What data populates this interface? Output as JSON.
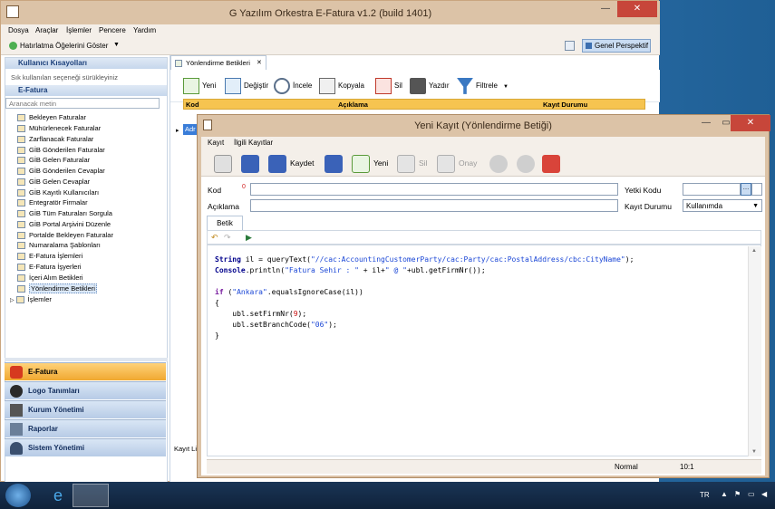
{
  "main_window": {
    "title": "G Yazılım Orkestra E-Fatura v1.2 (build 1401)",
    "menu": [
      "Dosya",
      "Araçlar",
      "İşlemler",
      "Pencere",
      "Yardım"
    ],
    "toolbar_reminder": "Hatırlatma Öğelerini Göster",
    "perspective_button": "Genel Perspektif"
  },
  "sidebar": {
    "shortcuts_header": "Kullanıcı Kısayolları",
    "shortcuts_hint": "Sık kullanılan seçeneği sürükleyiniz",
    "efatura_header": "E-Fatura",
    "search_placeholder": "Aranacak metin",
    "items": [
      "Bekleyen Faturalar",
      "Mühürlenecek Faturalar",
      "Zarflanacak Faturalar",
      "GİB Gönderilen Faturalar",
      "GİB Gelen Faturalar",
      "GİB Gönderilen Cevaplar",
      "GİB Gelen Cevaplar",
      "GİB Kayıtlı Kullanıcıları",
      "Entegratör Firmalar",
      "GİB Tüm Faturaları Sorgula",
      "GİB Portal Arşivini Düzenle",
      "Portalde Bekleyen Faturalar",
      "Numaralama Şablonları",
      "E-Fatura İşlemleri",
      "E-Fatura İşyerleri",
      "İçeri Alım Betikleri",
      "Yönlendirme Betikleri",
      "İşlemler"
    ],
    "nav_buttons": [
      "E-Fatura",
      "Logo Tanımları",
      "Kurum Yönetimi",
      "Raporlar",
      "Sistem Yönetimi"
    ]
  },
  "list_view": {
    "tab_label": "Yönlendirme Betikleri",
    "toolbar": [
      "Yeni",
      "Değiştir",
      "İncele",
      "Kopyala",
      "Sil",
      "Yazdır",
      "Filtrele"
    ],
    "columns": [
      "Kod",
      "Açıklama",
      "Kayıt Durumu"
    ],
    "row_partial": "Adr",
    "side_label_partial": "Kayıt Li"
  },
  "dialog": {
    "title": "Yeni Kayıt (Yönlendirme Betiği)",
    "menu": [
      "Kayıt",
      "İlgili Kayıtlar"
    ],
    "toolbar": {
      "save_label": "Kaydet",
      "new_label": "Yeni",
      "delete_label": "Sil",
      "ok_label": "Onay"
    },
    "fields": {
      "kod_label": "Kod",
      "kod_required": "0",
      "kod_value": "",
      "aciklama_label": "Açıklama",
      "aciklama_value": "",
      "yetki_label": "Yetki Kodu",
      "yetki_value": "",
      "kayit_durumu_label": "Kayıt Durumu",
      "kayit_durumu_value": "Kullanımda"
    },
    "editor_tab": "Betik",
    "code_lines": [
      "String il = queryText(\"//cac:AccountingCustomerParty/cac:Party/cac:PostalAddress/cbc:CityName\");",
      "Console.println(\"Fatura Sehir : \" + il+\" @ \"+ubl.getFirmNr());",
      "",
      "if (\"Ankara\".equalsIgnoreCase(il))",
      "{",
      "    ubl.setFirmNr(9);",
      "    ubl.setBranchCode(\"06\");",
      "}"
    ],
    "status_mode": "Normal",
    "status_pos": "10:1"
  },
  "taskbar": {
    "language": "TR"
  }
}
